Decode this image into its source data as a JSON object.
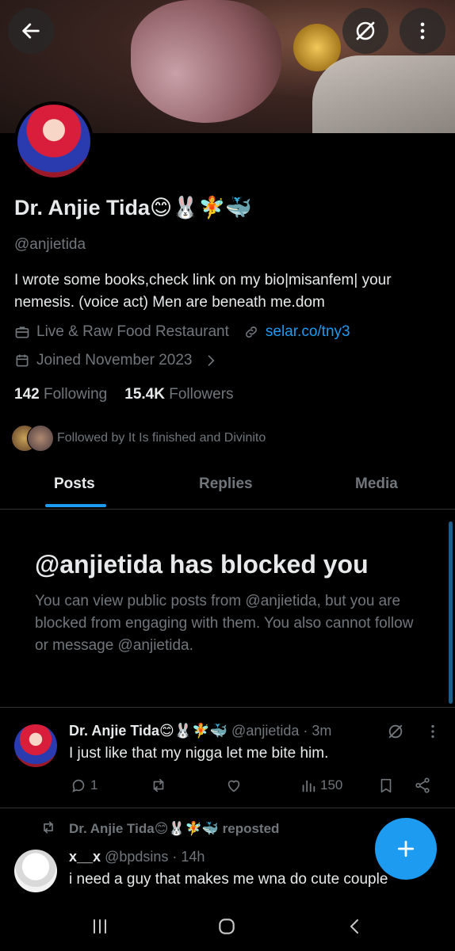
{
  "header": {
    "back_icon": "arrow-left-icon",
    "grok_icon": "slash-circle-icon",
    "more_icon": "vertical-dots-icon"
  },
  "profile": {
    "display_name": "Dr. Anjie Tida😊🐰🧚🐳",
    "handle": "@anjietida",
    "bio": "I wrote some books,check link on my bio|misanfem| your nemesis. (voice act) Men are beneath me.dom",
    "category": "Live & Raw Food Restaurant",
    "website": "selar.co/tny3",
    "joined": "Joined November 2023",
    "following_count": "142",
    "following_label": "Following",
    "followers_count": "15.4K",
    "followers_label": "Followers",
    "followed_by": "Followed by It Is finished and Divinito"
  },
  "tabs": [
    {
      "label": "Posts",
      "active": true
    },
    {
      "label": "Replies",
      "active": false
    },
    {
      "label": "Media",
      "active": false
    }
  ],
  "blocked": {
    "title": "@anjietida has blocked you",
    "text": "You can view public posts from @anjietida, but you are blocked from engaging with them. You also cannot follow or message @anjietida."
  },
  "tweets": [
    {
      "name": "Dr. Anjie Tida😊🐰🧚🐳",
      "handle": "@anjietida",
      "time": "· 3m",
      "text": "I just like that my nigga let me bite him.",
      "replies": "1",
      "views": "150"
    }
  ],
  "repost": {
    "label": "Dr. Anjie Tida😊🐰🧚🐳 reposted",
    "name": "x__x",
    "handle": "@bpdsins",
    "time": "· 14h",
    "text": "i need a guy that makes me wna do  cute couple"
  },
  "colors": {
    "accent": "#1d9bf0",
    "background": "#000000",
    "muted": "#71767b"
  }
}
